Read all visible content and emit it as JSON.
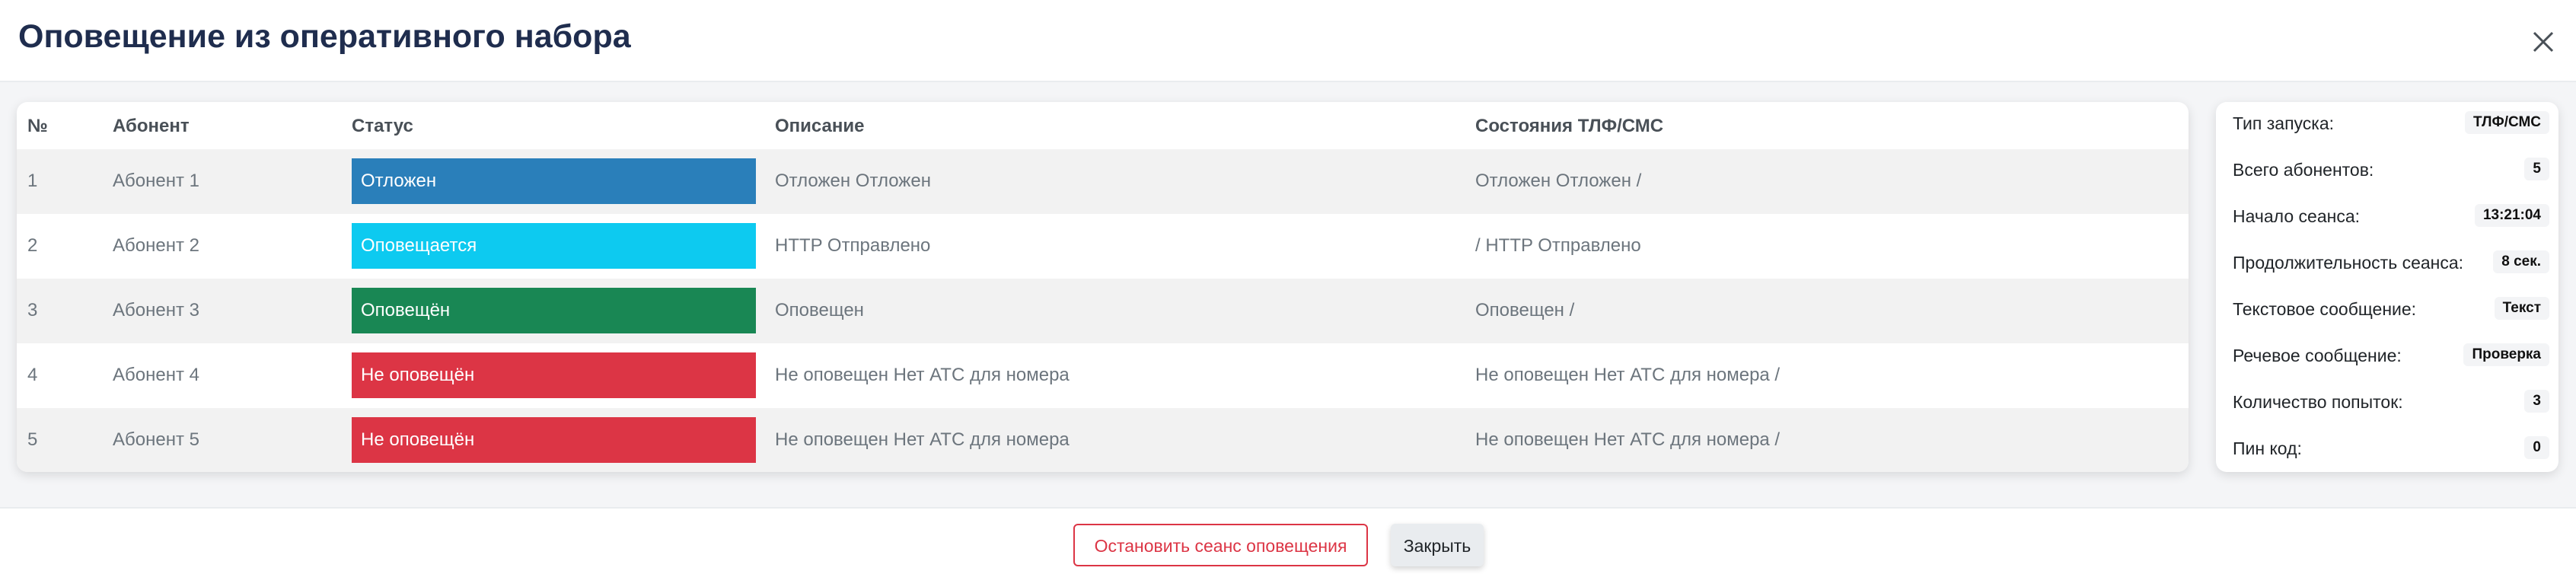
{
  "modal": {
    "title": "Оповещение из оперативного набора"
  },
  "table": {
    "columns": {
      "num": "№",
      "subscriber": "Абонент",
      "status": "Статус",
      "description": "Описание",
      "states": "Состояния ТЛФ/СМС"
    },
    "rows": [
      {
        "num": "1",
        "subscriber": "Абонент 1",
        "status": "Отложен",
        "status_color": "#2a7fba",
        "description": "Отложен Отложен",
        "states": "Отложен Отложен /"
      },
      {
        "num": "2",
        "subscriber": "Абонент 2",
        "status": "Оповещается",
        "status_color": "#0dcaf0",
        "description": "HTTP Отправлено",
        "states": "/ HTTP Отправлено"
      },
      {
        "num": "3",
        "subscriber": "Абонент 3",
        "status": "Оповещён",
        "status_color": "#198754",
        "description": "Оповещен",
        "states": "Оповещен /"
      },
      {
        "num": "4",
        "subscriber": "Абонент 4",
        "status": "Не оповещён",
        "status_color": "#dc3545",
        "description": "Не оповещен Нет АТС для номера",
        "states": "Не оповещен Нет АТС для номера /"
      },
      {
        "num": "5",
        "subscriber": "Абонент 5",
        "status": "Не оповещён",
        "status_color": "#dc3545",
        "description": "Не оповещен Нет АТС для номера",
        "states": "Не оповещен Нет АТС для номера /"
      }
    ]
  },
  "info": [
    {
      "label": "Тип запуска:",
      "value": "ТЛФ/СМС"
    },
    {
      "label": "Всего абонентов:",
      "value": "5"
    },
    {
      "label": "Начало сеанса:",
      "value": "13:21:04"
    },
    {
      "label": "Продолжительность сеанса:",
      "value": "8 сек."
    },
    {
      "label": "Текстовое сообщение:",
      "value": "Текст"
    },
    {
      "label": "Речевое сообщение:",
      "value": "Проверка"
    },
    {
      "label": "Количество попыток:",
      "value": "3"
    },
    {
      "label": "Пин код:",
      "value": "0"
    }
  ],
  "footer": {
    "stop_label": "Остановить сеанс оповещения",
    "close_label": "Закрыть"
  },
  "colors": {
    "title": "#1f2d4e",
    "danger": "#dc3545",
    "info": "#0dcaf0",
    "success": "#198754",
    "primary_status": "#2a7fba"
  },
  "icons": {
    "close": "close-icon"
  }
}
